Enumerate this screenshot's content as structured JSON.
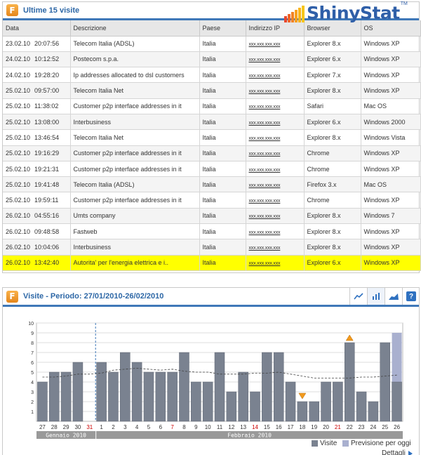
{
  "visits_panel": {
    "title": "Ultime 15 visite",
    "icon": "F",
    "logo_text": "ShinyStat",
    "logo_tm": "TM",
    "columns": [
      "Data",
      "Descrizione",
      "Paese",
      "Indirizzo IP",
      "Browser",
      "OS"
    ],
    "rows": [
      {
        "date": "23.02.10",
        "time": "20:07:56",
        "desc": "Telecom Italia (ADSL)",
        "country": "Italia",
        "ip": "xxx.xxx.xxx.xxx",
        "browser": "Explorer 8.x",
        "os": "Windows XP"
      },
      {
        "date": "24.02.10",
        "time": "10:12:52",
        "desc": "Postecom s.p.a.",
        "country": "Italia",
        "ip": "xxx.xxx.xxx.xxx",
        "browser": "Explorer 6.x",
        "os": "Windows XP"
      },
      {
        "date": "24.02.10",
        "time": "19:28:20",
        "desc": "Ip addresses allocated to dsl customers",
        "country": "Italia",
        "ip": "xxx.xxx.xxx.xxx",
        "browser": "Explorer 7.x",
        "os": "Windows XP"
      },
      {
        "date": "25.02.10",
        "time": "09:57:00",
        "desc": "Telecom Italia Net",
        "country": "Italia",
        "ip": "xxx.xxx.xxx.xxx",
        "browser": "Explorer 8.x",
        "os": "Windows XP"
      },
      {
        "date": "25.02.10",
        "time": "11:38:02",
        "desc": "Customer p2p interface addresses in it",
        "country": "Italia",
        "ip": "xxx.xxx.xxx.xxx",
        "browser": "Safari",
        "os": "Mac OS"
      },
      {
        "date": "25.02.10",
        "time": "13:08:00",
        "desc": "Interbusiness",
        "country": "Italia",
        "ip": "xxx.xxx.xxx.xxx",
        "browser": "Explorer 6.x",
        "os": "Windows 2000"
      },
      {
        "date": "25.02.10",
        "time": "13:46:54",
        "desc": "Telecom Italia Net",
        "country": "Italia",
        "ip": "xxx.xxx.xxx.xxx",
        "browser": "Explorer 8.x",
        "os": "Windows Vista"
      },
      {
        "date": "25.02.10",
        "time": "19:16:29",
        "desc": "Customer p2p interface addresses in it",
        "country": "Italia",
        "ip": "xxx.xxx.xxx.xxx",
        "browser": "Chrome",
        "os": "Windows XP"
      },
      {
        "date": "25.02.10",
        "time": "19:21:31",
        "desc": "Customer p2p interface addresses in it",
        "country": "Italia",
        "ip": "xxx.xxx.xxx.xxx",
        "browser": "Chrome",
        "os": "Windows XP"
      },
      {
        "date": "25.02.10",
        "time": "19:41:48",
        "desc": "Telecom Italia (ADSL)",
        "country": "Italia",
        "ip": "xxx.xxx.xxx.xxx",
        "browser": "Firefox 3.x",
        "os": "Mac OS"
      },
      {
        "date": "25.02.10",
        "time": "19:59:11",
        "desc": "Customer p2p interface addresses in it",
        "country": "Italia",
        "ip": "xxx.xxx.xxx.xxx",
        "browser": "Chrome",
        "os": "Windows XP"
      },
      {
        "date": "26.02.10",
        "time": "04:55:16",
        "desc": "Umts company",
        "country": "Italia",
        "ip": "xxx.xxx.xxx.xxx",
        "browser": "Explorer 8.x",
        "os": "Windows 7"
      },
      {
        "date": "26.02.10",
        "time": "09:48:58",
        "desc": "Fastweb",
        "country": "Italia",
        "ip": "xxx.xxx.xxx.xxx",
        "browser": "Explorer 8.x",
        "os": "Windows XP"
      },
      {
        "date": "26.02.10",
        "time": "10:04:06",
        "desc": "Interbusiness",
        "country": "Italia",
        "ip": "xxx.xxx.xxx.xxx",
        "browser": "Explorer 8.x",
        "os": "Windows XP"
      },
      {
        "date": "26.02.10",
        "time": "13:42:40",
        "desc": "Autorita' per l'energia elettrica e i..",
        "country": "Italia",
        "ip": "xxx.xxx.xxx.xxx",
        "browser": "Explorer 6.x",
        "os": "Windows XP",
        "highlight": true
      }
    ]
  },
  "chart_panel": {
    "title": "Visite - Periodo: 27/01/2010-26/02/2010",
    "icon": "F",
    "toolbar": {
      "line_icon": "line-chart-icon",
      "bar_icon": "bar-chart-icon",
      "area_icon": "area-chart-icon",
      "help_label": "?"
    },
    "legend": {
      "visits": "Visite",
      "forecast": "Previsione per oggi"
    },
    "details_label": "Dettagli",
    "colors": {
      "bar": "#7a8290",
      "forecast": "#a9b0cf",
      "trend": "#444444",
      "highlight": "#ffff00",
      "accent": "#3f78b8"
    }
  },
  "chart_data": {
    "type": "bar",
    "categories": [
      "27",
      "28",
      "29",
      "30",
      "31",
      "1",
      "2",
      "3",
      "4",
      "5",
      "6",
      "7",
      "8",
      "9",
      "10",
      "11",
      "12",
      "13",
      "14",
      "15",
      "16",
      "17",
      "18",
      "19",
      "20",
      "21",
      "22",
      "23",
      "24",
      "25",
      "26"
    ],
    "red_days": [
      "31",
      "7",
      "14",
      "21"
    ],
    "months": [
      {
        "label": "Gennaio 2010",
        "from": "27",
        "to": "31"
      },
      {
        "label": "Febbraio 2010",
        "from": "1",
        "to": "26"
      }
    ],
    "series": [
      {
        "name": "Visite",
        "values": [
          4,
          5,
          5,
          6,
          0,
          6,
          5,
          7,
          6,
          5,
          5,
          5,
          7,
          4,
          4,
          7,
          3,
          5,
          3,
          7,
          7,
          4,
          2,
          2,
          4,
          4,
          8,
          3,
          2,
          8,
          4
        ]
      },
      {
        "name": "Previsione per oggi",
        "values": [
          0,
          0,
          0,
          0,
          0,
          0,
          0,
          0,
          0,
          0,
          0,
          0,
          0,
          0,
          0,
          0,
          0,
          0,
          0,
          0,
          0,
          0,
          0,
          0,
          0,
          0,
          0,
          0,
          0,
          0,
          5
        ]
      }
    ],
    "trend": [
      4.5,
      4.5,
      4.6,
      4.8,
      4.8,
      4.9,
      5.2,
      5.3,
      5.4,
      5.3,
      5.2,
      5.3,
      5.1,
      5.0,
      5.0,
      4.8,
      4.8,
      4.8,
      4.9,
      4.9,
      5.0,
      4.8,
      4.6,
      4.4,
      4.4,
      4.4,
      4.4,
      4.5,
      4.5,
      4.6,
      4.7
    ],
    "markers": [
      {
        "category": "18",
        "direction": "down"
      },
      {
        "category": "22",
        "direction": "up"
      }
    ],
    "ylim": [
      0,
      10
    ],
    "yticks": [
      1,
      2,
      3,
      4,
      5,
      6,
      7,
      8,
      9,
      10
    ],
    "grid": true
  }
}
